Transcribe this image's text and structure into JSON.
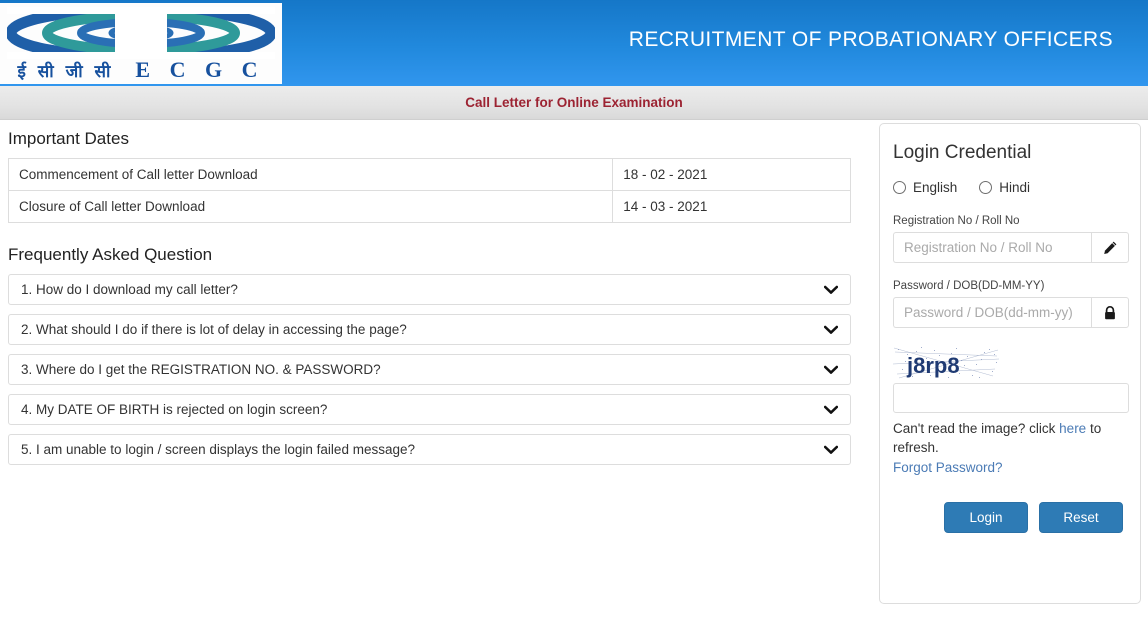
{
  "header": {
    "logo": {
      "hindi_text": "ई सी जी सी",
      "latin_text": "E C G C",
      "ring_outer_color": "#1f5fa8",
      "ring_mid_color": "#2f9a9a",
      "ring_inner_color": "#2a6fb5"
    },
    "title": "RECRUITMENT OF PROBATIONARY OFFICERS",
    "bg_color_top": "#1577c8",
    "bg_color_bottom": "#3196ee"
  },
  "subtitle": {
    "text": "Call Letter for Online Examination",
    "color": "#9c2332"
  },
  "important_dates": {
    "heading": "Important Dates",
    "rows": [
      {
        "label": "Commencement of Call letter Download",
        "value": "18 - 02 - 2021"
      },
      {
        "label": "Closure of Call letter Download",
        "value": "14 - 03 - 2021"
      }
    ]
  },
  "faq": {
    "heading": "Frequently Asked Question",
    "items": [
      {
        "question": "1. How do I download my call letter?"
      },
      {
        "question": "2. What should I do if there is lot of delay in accessing the page?"
      },
      {
        "question": "3. Where do I get the REGISTRATION NO. & PASSWORD?"
      },
      {
        "question": "4. My DATE OF BIRTH is rejected on login screen?"
      },
      {
        "question": "5. I am unable to login / screen displays the login failed message?"
      }
    ]
  },
  "login": {
    "title": "Login Credential",
    "language_options": [
      {
        "label": "English",
        "selected": false
      },
      {
        "label": "Hindi",
        "selected": false
      }
    ],
    "registration": {
      "label": "Registration No / Roll No",
      "placeholder": "Registration No / Roll No",
      "value": "",
      "addon_icon": "pencil-icon"
    },
    "password": {
      "label": "Password / DOB(DD-MM-YY)",
      "placeholder": "Password / DOB(dd-mm-yy)",
      "value": "",
      "addon_icon": "lock-icon"
    },
    "captcha": {
      "text": "j8rp8",
      "text_color": "#1f3a73",
      "input_value": "",
      "input_placeholder": ""
    },
    "refresh_prefix": "Can't read the image? click ",
    "refresh_link": "here",
    "refresh_suffix": " to refresh.",
    "forgot_password": "Forgot Password?",
    "buttons": {
      "login": "Login",
      "reset": "Reset",
      "color": "#2e7bb5"
    },
    "link_color": "#4b7bb5"
  }
}
